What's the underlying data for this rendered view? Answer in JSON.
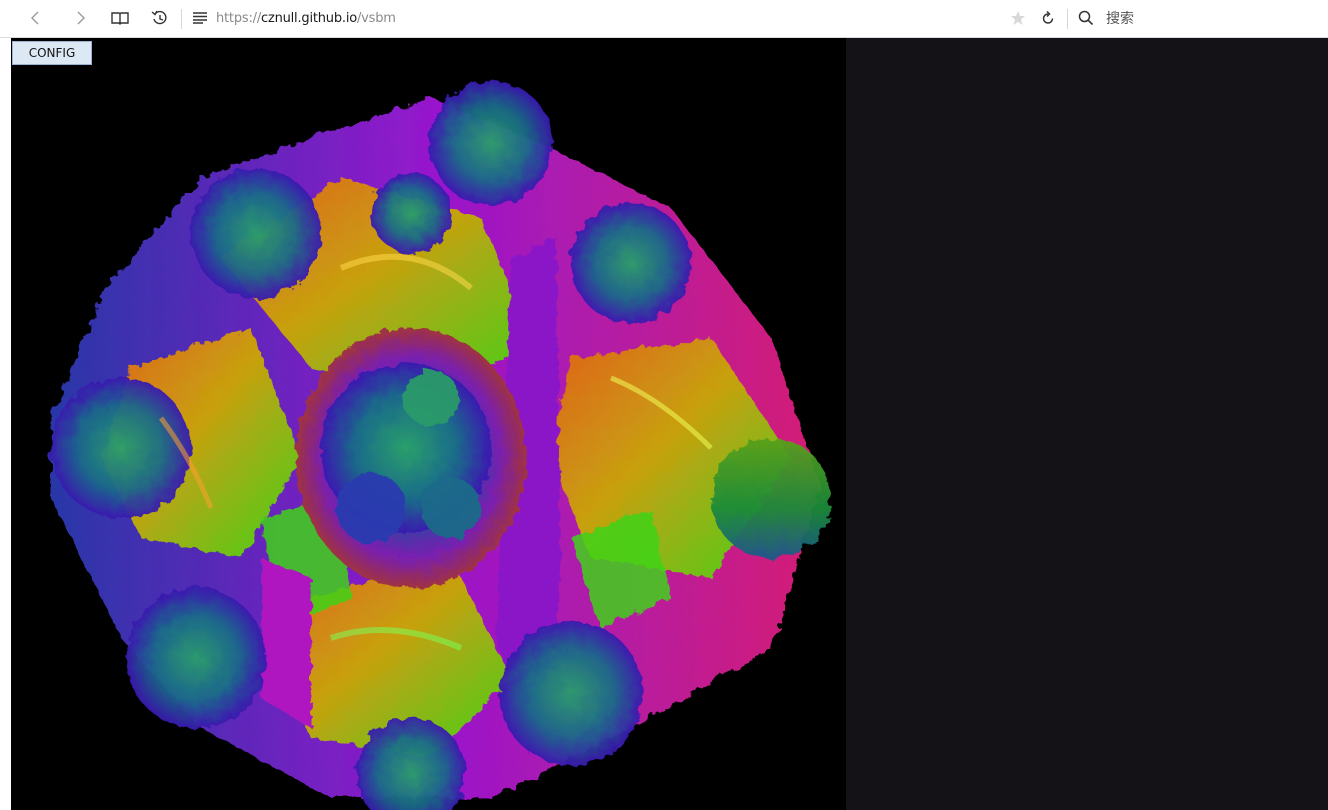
{
  "browser": {
    "url": {
      "scheme": "https://",
      "host": "cznull.github.io",
      "path": "/vsbm"
    },
    "search": {
      "placeholder": "搜索"
    }
  },
  "page": {
    "config_button_label": "CONFIG"
  },
  "colors": {
    "canvas_background": "#000000",
    "side_panel": "#141216",
    "config_button_bg": "#dde8f5",
    "fractal_palette": [
      "#7a0fd0",
      "#d21ae0",
      "#e8491a",
      "#c8a010",
      "#3fd21a",
      "#1a8a8a",
      "#2a3ab0",
      "#2a9a3a"
    ]
  },
  "icons": {
    "back": "chevron-left-icon",
    "forward": "chevron-right-icon",
    "reader": "book-icon",
    "history": "history-icon",
    "menu": "menu-icon",
    "favorite": "star-icon",
    "reload": "reload-icon",
    "search": "search-icon"
  }
}
